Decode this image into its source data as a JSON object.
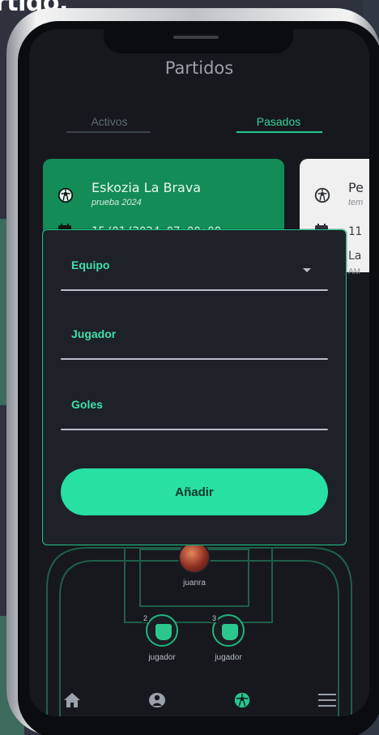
{
  "background": {
    "partial_title": "rtido."
  },
  "app": {
    "title": "Partidos"
  },
  "tabs": [
    {
      "label": "Activos"
    },
    {
      "label": "Pasados"
    }
  ],
  "cards": [
    {
      "title": "Eskozia La Brava",
      "subtitle": "prueba 2024",
      "date": "15/01/2024 07:00:00"
    },
    {
      "title": "Pe",
      "subtitle": "tem",
      "date": "11",
      "line": "La",
      "sub2": "AM"
    }
  ],
  "field": {
    "players": [
      {
        "name": "juanra"
      },
      {
        "name": "jugador",
        "number": "2"
      },
      {
        "name": "jugador",
        "number": "3"
      }
    ]
  },
  "modal": {
    "fields": [
      {
        "label": "Equipo"
      },
      {
        "label": "Jugador"
      },
      {
        "label": "Goles"
      }
    ],
    "button_label": "Añadir"
  },
  "nav": {
    "icons": [
      "home-icon",
      "user-icon",
      "soccer-ball-icon",
      "menu-icon"
    ]
  },
  "colors": {
    "accent": "#27e0a2",
    "card_green": "#138c57",
    "screen_bg": "#16181d",
    "modal_bg": "#1f2129"
  }
}
